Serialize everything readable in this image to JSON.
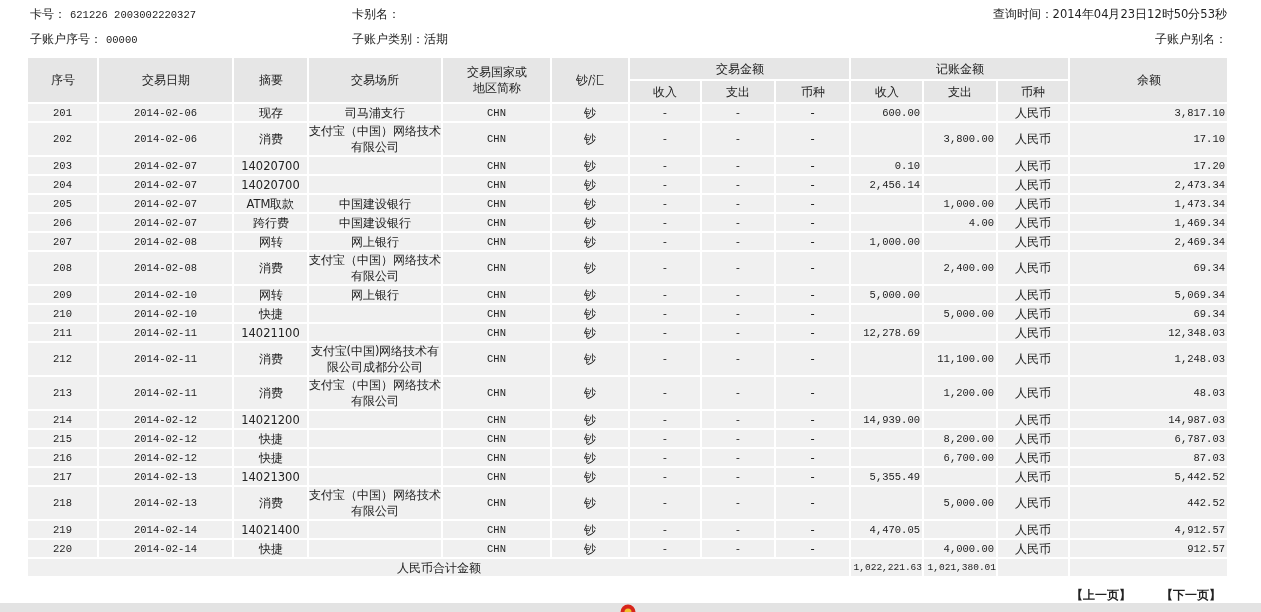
{
  "info": {
    "card_no": {
      "label": "卡号：",
      "value": "621226 2003002220327"
    },
    "card_alias": {
      "label": "卡别名："
    },
    "query_time": {
      "label": "查询时间：",
      "value": "2014年04月23日12时50分53秒"
    },
    "sub_account_no": {
      "label": "子账户序号：",
      "value": "00000"
    },
    "sub_account_type": {
      "label": "子账户类别：",
      "value": "活期"
    },
    "sub_account_alias": {
      "label": "子账户别名："
    }
  },
  "table": {
    "columns": [
      "序号",
      "交易日期",
      "摘要",
      "交易场所",
      "交易国家或地区简称",
      "钞/汇"
    ],
    "groups": [
      {
        "label": "交易金额",
        "columns": [
          "收入",
          "支出",
          "币种"
        ]
      },
      {
        "label": "记账金额",
        "columns": [
          "收入",
          "支出",
          "币种"
        ]
      }
    ],
    "last_column": "余额",
    "rows": [
      [
        "201",
        "2014-02-06",
        "现存",
        "司马浦支行",
        "CHN",
        "钞",
        "-",
        "-",
        "-",
        "600.00",
        "",
        "人民币",
        "3,817.10"
      ],
      [
        "202",
        "2014-02-06",
        "消费",
        "支付宝（中国）网络技术有限公司",
        "CHN",
        "钞",
        "-",
        "-",
        "-",
        "",
        "3,800.00",
        "人民币",
        "17.10"
      ],
      [
        "203",
        "2014-02-07",
        "14020700",
        "",
        "CHN",
        "钞",
        "-",
        "-",
        "-",
        "0.10",
        "",
        "人民币",
        "17.20"
      ],
      [
        "204",
        "2014-02-07",
        "14020700",
        "",
        "CHN",
        "钞",
        "-",
        "-",
        "-",
        "2,456.14",
        "",
        "人民币",
        "2,473.34"
      ],
      [
        "205",
        "2014-02-07",
        "ATM取款",
        "中国建设银行",
        "CHN",
        "钞",
        "-",
        "-",
        "-",
        "",
        "1,000.00",
        "人民币",
        "1,473.34"
      ],
      [
        "206",
        "2014-02-07",
        "跨行费",
        "中国建设银行",
        "CHN",
        "钞",
        "-",
        "-",
        "-",
        "",
        "4.00",
        "人民币",
        "1,469.34"
      ],
      [
        "207",
        "2014-02-08",
        "网转",
        "网上银行",
        "CHN",
        "钞",
        "-",
        "-",
        "-",
        "1,000.00",
        "",
        "人民币",
        "2,469.34"
      ],
      [
        "208",
        "2014-02-08",
        "消费",
        "支付宝（中国）网络技术有限公司",
        "CHN",
        "钞",
        "-",
        "-",
        "-",
        "",
        "2,400.00",
        "人民币",
        "69.34"
      ],
      [
        "209",
        "2014-02-10",
        "网转",
        "网上银行",
        "CHN",
        "钞",
        "-",
        "-",
        "-",
        "5,000.00",
        "",
        "人民币",
        "5,069.34"
      ],
      [
        "210",
        "2014-02-10",
        "快捷",
        "",
        "CHN",
        "钞",
        "-",
        "-",
        "-",
        "",
        "5,000.00",
        "人民币",
        "69.34"
      ],
      [
        "211",
        "2014-02-11",
        "14021100",
        "",
        "CHN",
        "钞",
        "-",
        "-",
        "-",
        "12,278.69",
        "",
        "人民币",
        "12,348.03"
      ],
      [
        "212",
        "2014-02-11",
        "消费",
        "支付宝(中国)网络技术有限公司成都分公司",
        "CHN",
        "钞",
        "-",
        "-",
        "-",
        "",
        "11,100.00",
        "人民币",
        "1,248.03"
      ],
      [
        "213",
        "2014-02-11",
        "消费",
        "支付宝（中国）网络技术有限公司",
        "CHN",
        "钞",
        "-",
        "-",
        "-",
        "",
        "1,200.00",
        "人民币",
        "48.03"
      ],
      [
        "214",
        "2014-02-12",
        "14021200",
        "",
        "CHN",
        "钞",
        "-",
        "-",
        "-",
        "14,939.00",
        "",
        "人民币",
        "14,987.03"
      ],
      [
        "215",
        "2014-02-12",
        "快捷",
        "",
        "CHN",
        "钞",
        "-",
        "-",
        "-",
        "",
        "8,200.00",
        "人民币",
        "6,787.03"
      ],
      [
        "216",
        "2014-02-12",
        "快捷",
        "",
        "CHN",
        "钞",
        "-",
        "-",
        "-",
        "",
        "6,700.00",
        "人民币",
        "87.03"
      ],
      [
        "217",
        "2014-02-13",
        "14021300",
        "",
        "CHN",
        "钞",
        "-",
        "-",
        "-",
        "5,355.49",
        "",
        "人民币",
        "5,442.52"
      ],
      [
        "218",
        "2014-02-13",
        "消费",
        "支付宝（中国）网络技术有限公司",
        "CHN",
        "钞",
        "-",
        "-",
        "-",
        "",
        "5,000.00",
        "人民币",
        "442.52"
      ],
      [
        "219",
        "2014-02-14",
        "14021400",
        "",
        "CHN",
        "钞",
        "-",
        "-",
        "-",
        "4,470.05",
        "",
        "人民币",
        "4,912.57"
      ],
      [
        "220",
        "2014-02-14",
        "快捷",
        "",
        "CHN",
        "钞",
        "-",
        "-",
        "-",
        "",
        "4,000.00",
        "人民币",
        "912.57"
      ]
    ],
    "total": {
      "label": "人民币合计金额",
      "income": "1,022,221.63",
      "expense": "1,021,380.01"
    }
  },
  "pagination": [
    "【上一页】",
    "【下一页】"
  ]
}
